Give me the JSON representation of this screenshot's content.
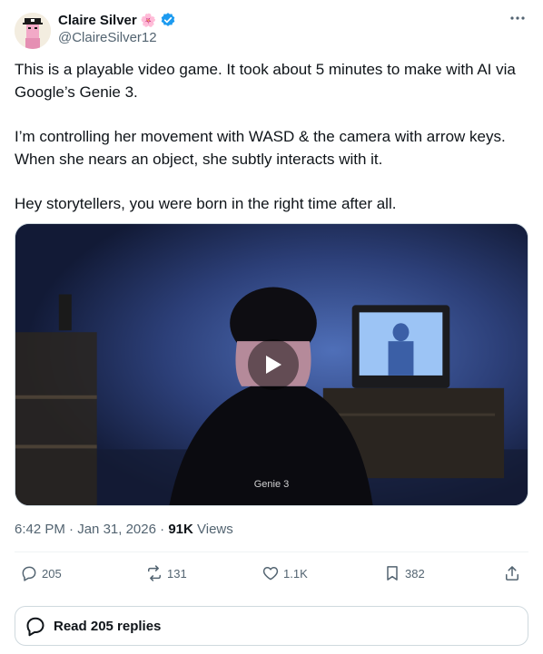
{
  "author": {
    "display_name": "Claire Silver",
    "handle": "@ClaireSilver12",
    "verified": true,
    "name_emoji": "🌸",
    "avatar_icon": "avatar-icon"
  },
  "tweet": {
    "paragraphs": [
      "This is a playable video game. It took about 5 minutes to make with AI via Google’s Genie 3.",
      "I’m controlling her movement with WASD & the camera with arrow keys. When she nears an object, she subtly interacts with it.",
      "Hey storytellers, you were born in the right time after all."
    ]
  },
  "media": {
    "watermark": "Genie 3",
    "type": "video"
  },
  "meta": {
    "time": "6:42 PM",
    "separator": "·",
    "date": "Jan 31, 2026",
    "views_count": "91K",
    "views_label": "Views"
  },
  "actions": {
    "replies": "205",
    "reposts": "131",
    "likes": "1.1K",
    "bookmarks": "382"
  },
  "read_replies": {
    "label": "Read 205 replies"
  },
  "colors": {
    "text_primary": "#0f1419",
    "text_secondary": "#536471",
    "verified_blue": "#1d9bf0",
    "border": "#cfd9de"
  }
}
